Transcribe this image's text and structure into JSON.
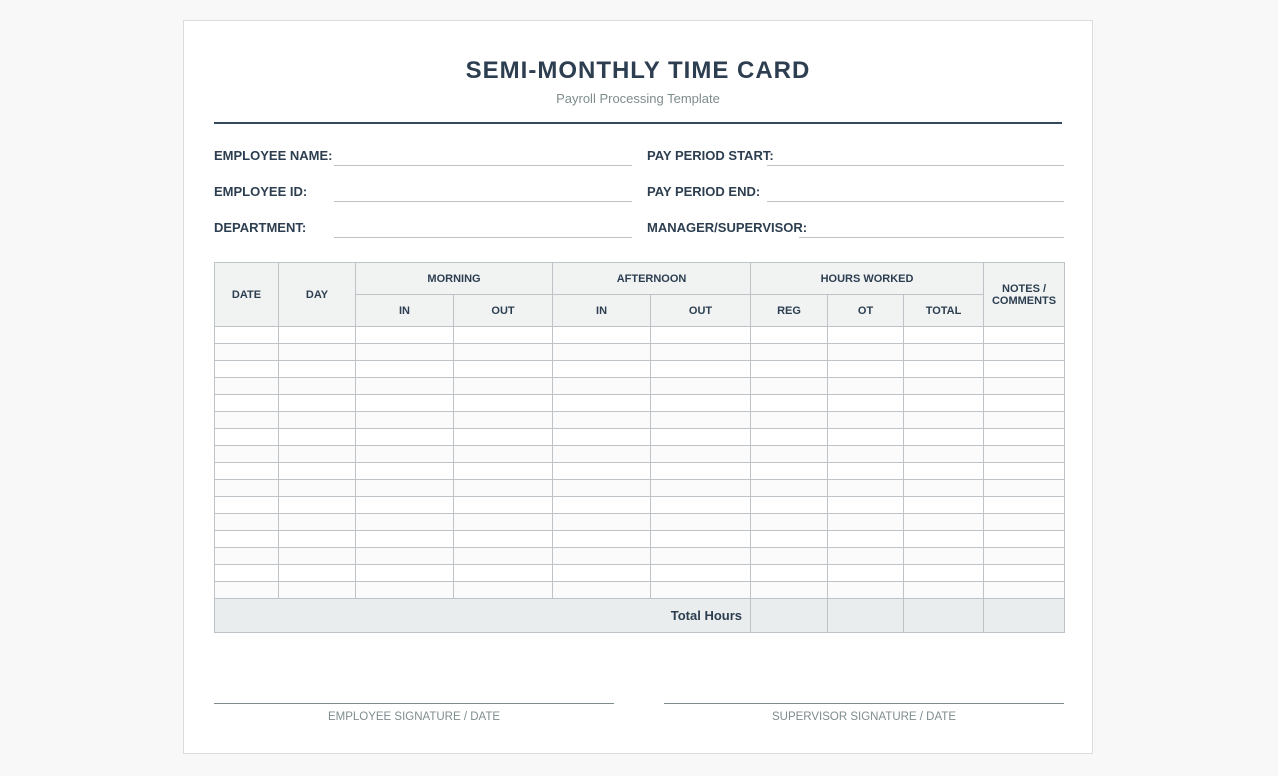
{
  "header": {
    "title": "SEMI-MONTHLY TIME CARD",
    "subtitle": "Payroll Processing Template"
  },
  "fields": {
    "employee_name": "EMPLOYEE NAME:",
    "employee_id": "EMPLOYEE ID:",
    "department": "DEPARTMENT:",
    "pay_period_start": "PAY PERIOD START:",
    "pay_period_end": "PAY PERIOD END:",
    "manager": "MANAGER/SUPERVISOR:"
  },
  "table": {
    "date": "DATE",
    "day": "DAY",
    "morning": "MORNING",
    "afternoon": "AFTERNOON",
    "hours_worked": "HOURS WORKED",
    "notes": "NOTES / COMMENTS",
    "morning_in": "IN",
    "morning_out": "OUT",
    "afternoon_in": "IN",
    "afternoon_out": "OUT",
    "reg": "REG",
    "ot": "OT",
    "total": "TOTAL",
    "total_hours": "Total Hours"
  },
  "signatures": {
    "employee": "EMPLOYEE SIGNATURE / DATE",
    "supervisor": "SUPERVISOR SIGNATURE / DATE"
  }
}
